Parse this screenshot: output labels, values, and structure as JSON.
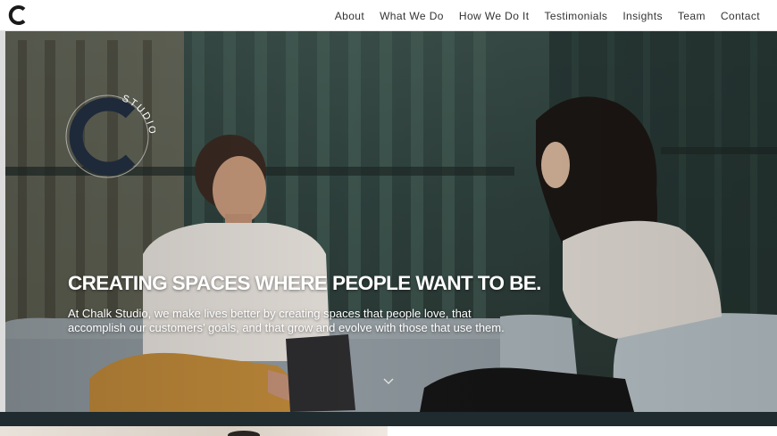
{
  "header": {
    "logo_letter": "C",
    "nav": [
      "About",
      "What We Do",
      "How We Do It",
      "Testimonials",
      "Insights",
      "Team",
      "Contact"
    ]
  },
  "hero": {
    "mark_word": "STUDIO",
    "title": "CREATING SPACES WHERE PEOPLE WANT TO BE.",
    "subtitle_line1": "At Chalk Studio, we make lives better by creating spaces that people love, that",
    "subtitle_line2": "accomplish our customers’ goals, and that grow and evolve with those that use them.",
    "scroll_icon": "chevron-down-icon"
  },
  "colors": {
    "band": "#1f2b2f",
    "text_nav": "#333333",
    "hero_text": "#ffffff",
    "mark": "#1e2a3a"
  }
}
